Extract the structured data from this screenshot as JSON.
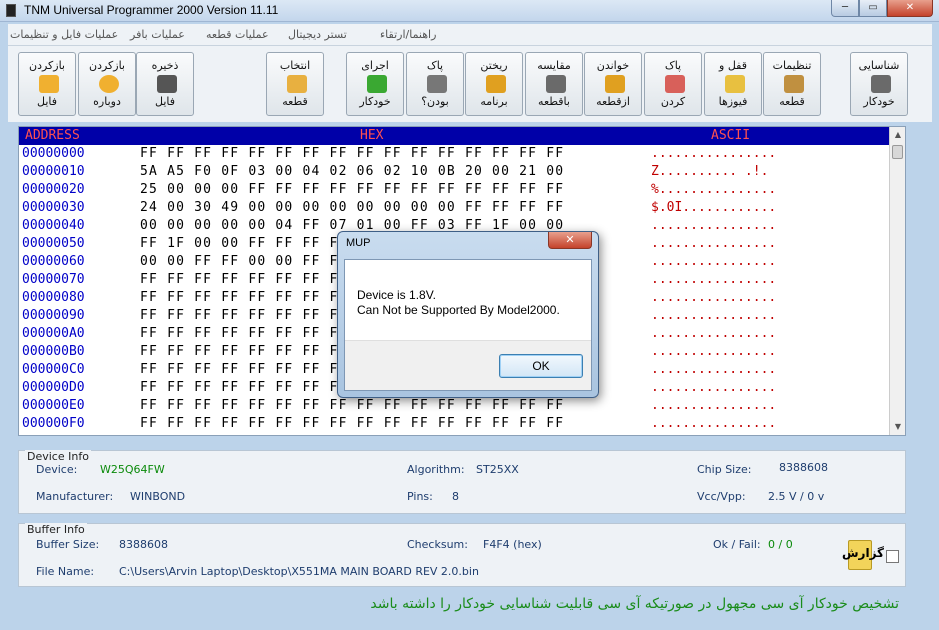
{
  "window": {
    "title": "TNM  Universal Programmer 2000   Version 11.11",
    "minimize": "─",
    "maximize": "▭",
    "close": "✕"
  },
  "menu": [
    "عملیات فایل و تنظیمات",
    "عملیات بافر",
    "عملیات قطعه",
    "تستر دیجیتال",
    "راهنما/ارتقاء"
  ],
  "toolbar": {
    "reload_file": {
      "line1": "بازکردن",
      "line2": "فایل"
    },
    "reopen": {
      "line1": "بازکردن",
      "line2": "دوباره"
    },
    "save_file": {
      "line1": "ذخیره",
      "line2": "فایل"
    },
    "select_chip": {
      "line1": "انتخاب",
      "line2": "قطعه"
    },
    "auto_run": {
      "line1": "اجرای",
      "line2": "خودکار"
    },
    "blank_check": {
      "line1": "پاک",
      "line2": "بودن؟"
    },
    "program": {
      "line1": "ریختن",
      "line2": "برنامه"
    },
    "verify": {
      "line1": "مقایسه",
      "line2": "باقطعه"
    },
    "read": {
      "line1": "خواندن",
      "line2": "ازقطعه"
    },
    "erase": {
      "line1": "پاک",
      "line2": "کردن"
    },
    "lock_fuse": {
      "line1": "قفل و",
      "line2": "فیوزها"
    },
    "settings": {
      "line1": "تنظیمات",
      "line2": "قطعه"
    },
    "auto_detect": {
      "line1": "شناسایی",
      "line2": "خودکار"
    }
  },
  "hex": {
    "header_address": "ADDRESS",
    "header_hex": "HEX",
    "header_ascii": "ASCII",
    "rows": [
      {
        "addr": "00000000",
        "hex": "FF FF FF FF FF FF FF FF FF FF FF FF FF FF FF FF",
        "ascii": "................"
      },
      {
        "addr": "00000010",
        "hex": "5A A5 F0 0F 03 00 04 02 06 02 10 0B 20 00 21 00",
        "ascii": "Z.......... .!."
      },
      {
        "addr": "00000020",
        "hex": "25 00 00 00 FF FF FF FF FF FF FF FF FF FF FF FF",
        "ascii": "%..............."
      },
      {
        "addr": "00000030",
        "hex": "24 00 30 49 00 00 00 00 00 00 00 00 FF FF FF FF",
        "ascii": "$.0I............"
      },
      {
        "addr": "00000040",
        "hex": "00 00 00 00 00 04 FF 07 01 00 FF 03 FF 1F 00 00",
        "ascii": "................"
      },
      {
        "addr": "00000050",
        "hex": "FF 1F 00 00 FF FF FF FF FF FF FF FF FF FF FF FF",
        "ascii": "................"
      },
      {
        "addr": "00000060",
        "hex": "00 00 FF FF 00 00 FF FF FF FF FF FF FF FF FF FF",
        "ascii": "................"
      },
      {
        "addr": "00000070",
        "hex": "FF FF FF FF FF FF FF FF FF FF FF FF FF FF FF FF",
        "ascii": "................"
      },
      {
        "addr": "00000080",
        "hex": "FF FF FF FF FF FF FF FF FF FF FF FF FF FF FF FF",
        "ascii": "................"
      },
      {
        "addr": "00000090",
        "hex": "FF FF FF FF FF FF FF FF FF FF FF FF FF FF FF FF",
        "ascii": "................"
      },
      {
        "addr": "000000A0",
        "hex": "FF FF FF FF FF FF FF FF FF FF FF FF FF FF FF FF",
        "ascii": "................"
      },
      {
        "addr": "000000B0",
        "hex": "FF FF FF FF FF FF FF FF FF FF FF FF FF FF FF FF",
        "ascii": "................"
      },
      {
        "addr": "000000C0",
        "hex": "FF FF FF FF FF FF FF FF FF FF FF FF FF FF FF FF",
        "ascii": "................"
      },
      {
        "addr": "000000D0",
        "hex": "FF FF FF FF FF FF FF FF FF FF FF FF FF FF FF FF",
        "ascii": "................"
      },
      {
        "addr": "000000E0",
        "hex": "FF FF FF FF FF FF FF FF FF FF FF FF FF FF FF FF",
        "ascii": "................"
      },
      {
        "addr": "000000F0",
        "hex": "FF FF FF FF FF FF FF FF FF FF FF FF FF FF FF FF",
        "ascii": "................"
      }
    ]
  },
  "device_info": {
    "title": "Device Info",
    "device_label": "Device:",
    "device": "W25Q64FW",
    "algorithm_label": "Algorithm:",
    "algorithm": "ST25XX",
    "chip_size_label": "Chip Size:",
    "chip_size": "8388608",
    "manufacturer_label": "Manufacturer:",
    "manufacturer": "WINBOND",
    "pins_label": "Pins:",
    "pins": "8",
    "vcc_label": "Vcc/Vpp:",
    "vcc": "2.5 V / 0 v"
  },
  "buffer_info": {
    "title": "Buffer Info",
    "buffer_size_label": "Buffer Size:",
    "buffer_size": "8388608",
    "checksum_label": "Checksum:",
    "checksum": "F4F4 (hex)",
    "okfail_label": "Ok / Fail:",
    "okfail": "0 / 0",
    "file_label": "File Name:",
    "file": "C:\\Users\\Arvin Laptop\\Desktop\\X551MA MAIN BOARD REV 2.0.bin"
  },
  "report_label": "گزارش",
  "status_message": "تشخیص خودکار آی سی مجهول در صورتیکه آی سی قابلیت شناسایی خودکار را داشته باشد",
  "dialog": {
    "title": "MUP",
    "close": "✕",
    "line1": "Device is 1.8V.",
    "line2": "Can Not be Supported By Model2000.",
    "ok": "OK"
  },
  "colors": {
    "address": "#0000c8",
    "ascii": "#c00000",
    "header_bg": "#0000a8",
    "status": "#1a8c1a",
    "field_value": "#0a8a0a"
  }
}
